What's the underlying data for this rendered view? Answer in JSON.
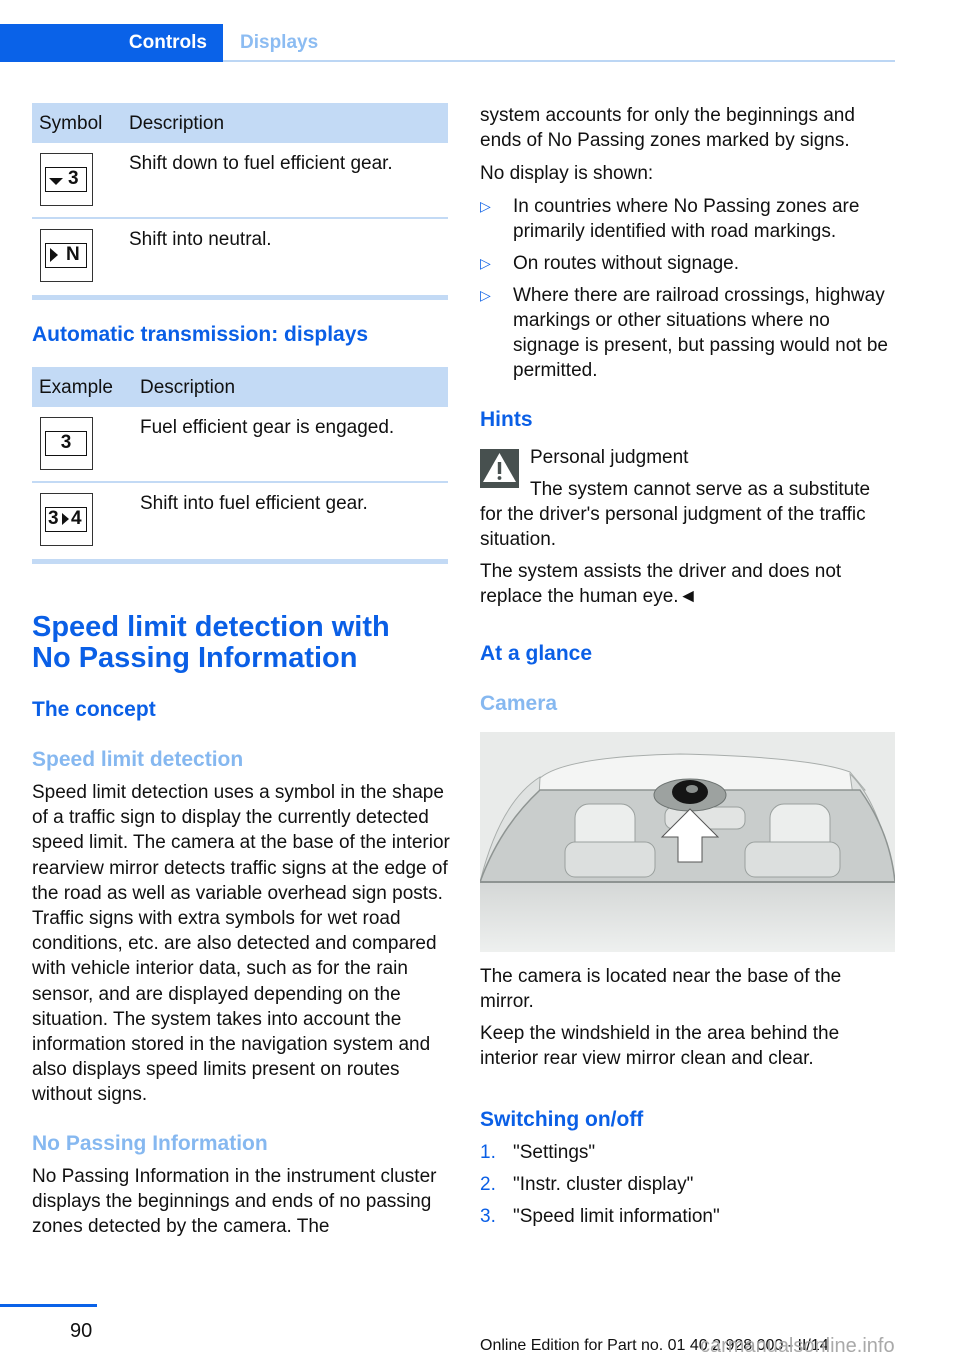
{
  "header": {
    "tabs": [
      {
        "label": "Controls",
        "active": true
      },
      {
        "label": "Displays",
        "active": false
      }
    ]
  },
  "colors": {
    "accent": "#0a62e8",
    "heading_blue": "#0a5fe6",
    "subheading_light_blue": "#86b8f0",
    "table_header_bg": "#c3daf5"
  },
  "left_column": {
    "table1": {
      "headers": [
        "Symbol",
        "Description"
      ],
      "rows": [
        {
          "symbol": "shift-down-3",
          "symbol_text": "3",
          "description": "Shift down to fuel efficient gear."
        },
        {
          "symbol": "shift-neutral",
          "symbol_text": "N",
          "description": "Shift into neutral."
        }
      ]
    },
    "auto_heading": "Automatic transmission: displays",
    "table2": {
      "headers": [
        "Example",
        "Description"
      ],
      "rows": [
        {
          "symbol": "gear-3-engaged",
          "symbol_text": "3",
          "description": "Fuel efficient gear is engaged."
        },
        {
          "symbol": "gear-3-to-4",
          "symbol_text_a": "3",
          "symbol_text_b": "4",
          "description": "Shift into fuel efficient gear."
        }
      ]
    },
    "section_title": "Speed limit detection with No Passing Information",
    "section_title_line1": "Speed limit detection with",
    "section_title_line2": "No Passing Information",
    "concept_heading": "The concept",
    "speed_limit_heading": "Speed limit detection",
    "speed_limit_text": "Speed limit detection uses a symbol in the shape of a traffic sign to display the currently detected speed limit. The camera at the base of the interior rearview mirror detects traffic signs at the edge of the road as well as variable overhead sign posts. Traffic signs with extra symbols for wet road conditions, etc. are also detected and compared with vehicle interior data, such as for the rain sensor, and are displayed depending on the situation. The system takes into account the information stored in the navigation system and also displays speed limits present on routes without signs.",
    "no_passing_heading": "No Passing Information",
    "no_passing_text": "No Passing Information in the instrument cluster displays the beginnings and ends of no passing zones detected by the camera. The"
  },
  "right_column": {
    "continued_text": "system accounts for only the beginnings and ends of No Passing zones marked by signs.",
    "no_display_intro": "No display is shown:",
    "no_display_items": [
      "In countries where No Passing zones are primarily identified with road markings.",
      "On routes without signage.",
      "Where there are railroad crossings, highway markings or other situations where no signage is present, but passing would not be permitted."
    ],
    "hints_heading": "Hints",
    "warning_title": "Personal judgment",
    "warning_text": "The system cannot serve as a substitute for the driver's personal judgment of the traffic situation.",
    "warning_text2": "The system assists the driver and does not replace the human eye.◄",
    "at_a_glance_heading": "At a glance",
    "camera_heading": "Camera",
    "camera_image_alt": "Windshield view with camera at base of interior mirror, arrow pointing to camera",
    "camera_text1": "The camera is located near the base of the mirror.",
    "camera_text2": "Keep the windshield in the area behind the interior rear view mirror clean and clear.",
    "switching_heading": "Switching on/off",
    "steps": [
      {
        "num": "1.",
        "text": "\"Settings\""
      },
      {
        "num": "2.",
        "text": "\"Instr. cluster display\""
      },
      {
        "num": "3.",
        "text": "\"Speed limit information\""
      }
    ]
  },
  "footer": {
    "page_number": "90",
    "edition": "Online Edition for Part no. 01 40 2 928 000 - II/14",
    "watermark": "carmanualsonline.info"
  }
}
